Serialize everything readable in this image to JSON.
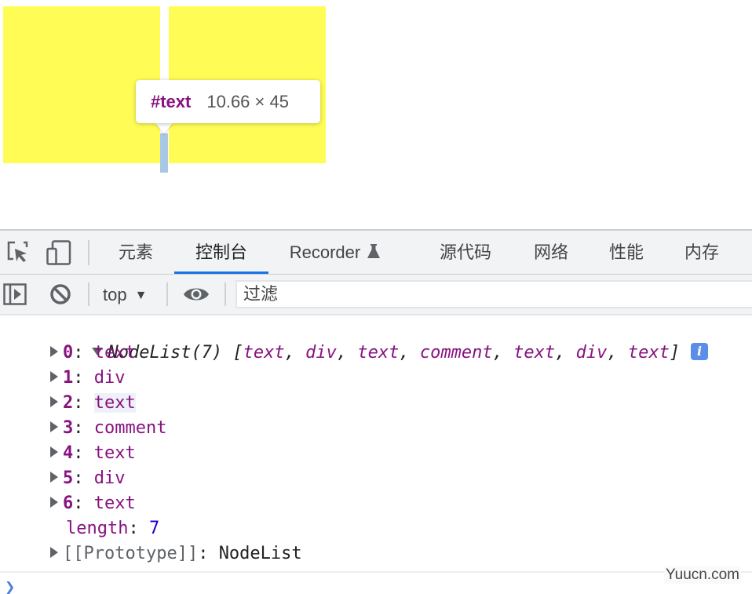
{
  "page": {
    "tooltip": {
      "node_name": "#text",
      "size": "10.66 × 45"
    },
    "colors": {
      "box": "#fffd55",
      "highlight": "#a8c7e4",
      "node_name": "#881280"
    }
  },
  "devtools": {
    "tabs": [
      {
        "label": "元素",
        "active": false
      },
      {
        "label": "控制台",
        "active": true
      },
      {
        "label": "Recorder",
        "active": false
      },
      {
        "label": "源代码",
        "active": false
      },
      {
        "label": "网络",
        "active": false
      },
      {
        "label": "性能",
        "active": false
      },
      {
        "label": "内存",
        "active": false
      }
    ],
    "toolbar": {
      "context": "top",
      "filter_placeholder": "过滤",
      "filter_value": ""
    },
    "console": {
      "summary": {
        "type": "NodeList(7)",
        "open_bracket": "[",
        "items": [
          "text",
          "div",
          "text",
          "comment",
          "text",
          "div",
          "text"
        ],
        "close_bracket": "]"
      },
      "entries": [
        {
          "index": "0",
          "value": "text"
        },
        {
          "index": "1",
          "value": "div"
        },
        {
          "index": "2",
          "value": "text"
        },
        {
          "index": "3",
          "value": "comment"
        },
        {
          "index": "4",
          "value": "text"
        },
        {
          "index": "5",
          "value": "div"
        },
        {
          "index": "6",
          "value": "text"
        }
      ],
      "length": {
        "key": "length",
        "value": "7"
      },
      "prototype": {
        "key": "[[Prototype]]",
        "value": "NodeList"
      }
    }
  },
  "watermark": "Yuucn.com"
}
